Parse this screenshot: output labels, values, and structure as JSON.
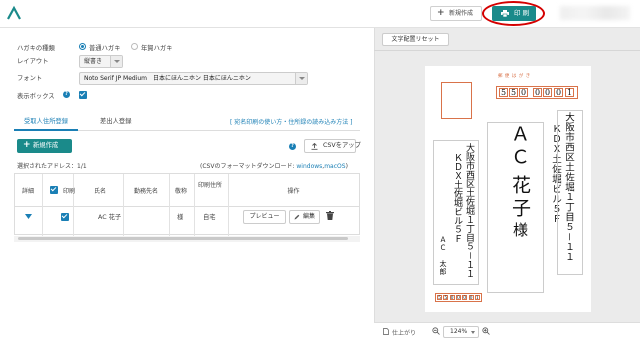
{
  "header": {
    "new_button": "新規作成",
    "print_button": "印 刷"
  },
  "settings": {
    "hagaki_type_label": "ハガキの種類",
    "hagaki_options": [
      "普通ハガキ",
      "年賀ハガキ"
    ],
    "layout_label": "レイアウト",
    "layout_value": "縦書き",
    "font_label": "フォント",
    "font_value": "Noto Serif JP Medium　日本にほんニホン 日本にほんニホン",
    "display_box_label": "表示ボックス"
  },
  "tabs": [
    "受取人住所登録",
    "差出人登録"
  ],
  "howto_link": "[ 宛名印刷の使い方・住所録の読み込み方法 ]",
  "add_button": "新規作成",
  "csv_button": "CSVをアップ",
  "selected_count": "選択されたアドレス：1/1",
  "csv_format": {
    "prefix": "(CSVのフォーマットダウンロード:",
    "windows": "windows",
    "sep": ",",
    "mac": "macOS",
    "suffix": ")"
  },
  "table": {
    "headers": [
      "詳細",
      "印刷",
      "氏名",
      "勤務先名",
      "敬称",
      "印刷住所",
      "操作"
    ],
    "rows": [
      {
        "name": "AC 花子",
        "honorific": "様",
        "address_type": "自宅",
        "preview": "プレビュー",
        "edit": "編集"
      }
    ]
  },
  "preview": {
    "reset_button": "文字配置リセット",
    "card_header": "郵 便 は が き",
    "postal_code": [
      "5",
      "5",
      "0",
      "0",
      "0",
      "0",
      "1"
    ],
    "recipient_address_1": "大阪市西区土佐堀１丁目５－１１",
    "recipient_address_2": "ＫＤＸ土佐堀ビル５Ｆ",
    "recipient_name_family": "ＡＣ",
    "recipient_name_given": "花子",
    "recipient_honorific": "様",
    "sender_address_1": "大阪市西区土佐堀１丁目５－１１",
    "sender_address_2": "ＫＤＸ土佐堀ビル５Ｆ",
    "sender_name": "ＡＣ　太郎",
    "sender_postal_code": [
      "5",
      "5",
      "0",
      "0",
      "0",
      "0",
      "1"
    ],
    "finish_label": "仕上がり",
    "zoom": "124%"
  },
  "colors": {
    "primary": "#1a8a8a",
    "link": "#1a7fb5",
    "postal_box": "#d9734a",
    "highlight_ring": "#d40000"
  }
}
